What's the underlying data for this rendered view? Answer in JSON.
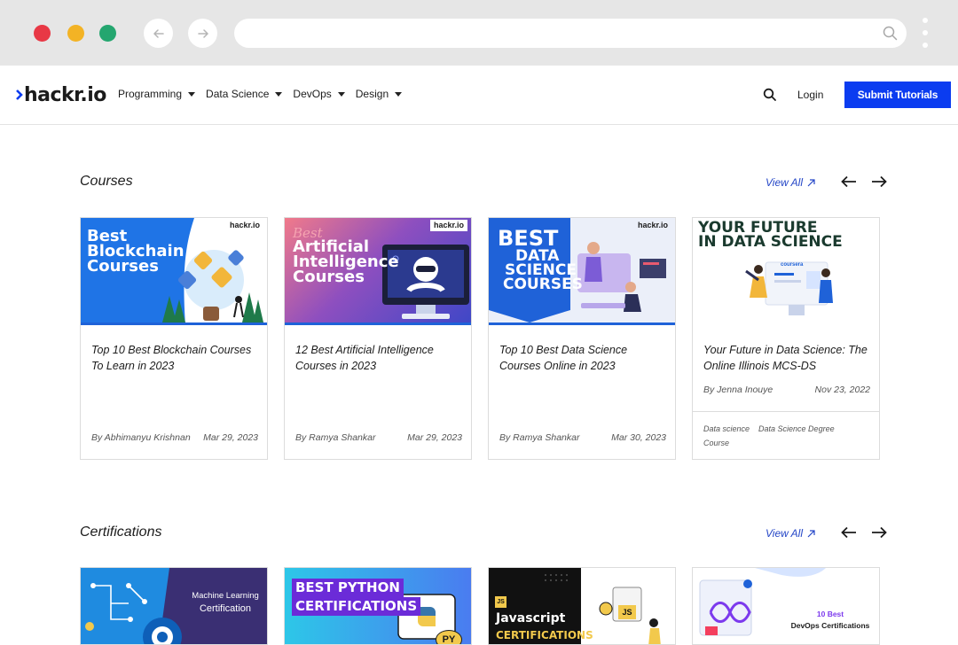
{
  "site": {
    "logo": "hackr.io",
    "menu": [
      "Programming",
      "Data Science",
      "DevOps",
      "Design"
    ],
    "login": "Login",
    "submit": "Submit Tutorials"
  },
  "sections": {
    "courses": {
      "title": "Courses",
      "view_all": "View All"
    },
    "certifications": {
      "title": "Certifications",
      "view_all": "View All"
    }
  },
  "courses": [
    {
      "image_text": [
        "Best",
        "Blockchain",
        "Courses"
      ],
      "image_tag": "hackr.io",
      "title": "Top 10 Best Blockchain Courses To Learn in 2023",
      "author": "By Abhimanyu Krishnan",
      "date": "Mar 29, 2023"
    },
    {
      "image_text": [
        "Best",
        "Artificial",
        "Intelligence",
        "Courses"
      ],
      "image_tag": "hackr.io",
      "title": "12 Best Artificial Intelligence Courses in 2023",
      "author": "By Ramya Shankar",
      "date": "Mar 29, 2023"
    },
    {
      "image_text": [
        "BEST",
        "DATA",
        "SCIENCE",
        "COURSES"
      ],
      "image_tag": "hackr.io",
      "title": "Top 10 Best Data Science Courses Online in 2023",
      "author": "By Ramya Shankar",
      "date": "Mar 30, 2023"
    },
    {
      "image_text": [
        "YOUR FUTURE",
        "IN DATA SCIENCE"
      ],
      "image_tag": "coursera",
      "title": "Your Future in Data Science: The Online Illinois MCS-DS",
      "author": "By Jenna Inouye",
      "date": "Nov 23, 2022",
      "tags": [
        "Data science",
        "Data Science Degree",
        "Course"
      ]
    }
  ],
  "certifications": [
    {
      "image_text": [
        "Machine Learning",
        "Certification"
      ]
    },
    {
      "image_text": [
        "BEST PYTHON",
        "CERTIFICATIONS"
      ],
      "badge": "PY"
    },
    {
      "image_text": [
        "Javascript",
        "CERTIFICATIONS"
      ],
      "badge": "JS",
      "badge2": "JS"
    },
    {
      "image_text": [
        "10 Best",
        "DevOps Certifications"
      ]
    }
  ],
  "colors": {
    "accent": "#0b3cf0",
    "link": "#2446c7",
    "chrome": "#e6e6e6"
  }
}
